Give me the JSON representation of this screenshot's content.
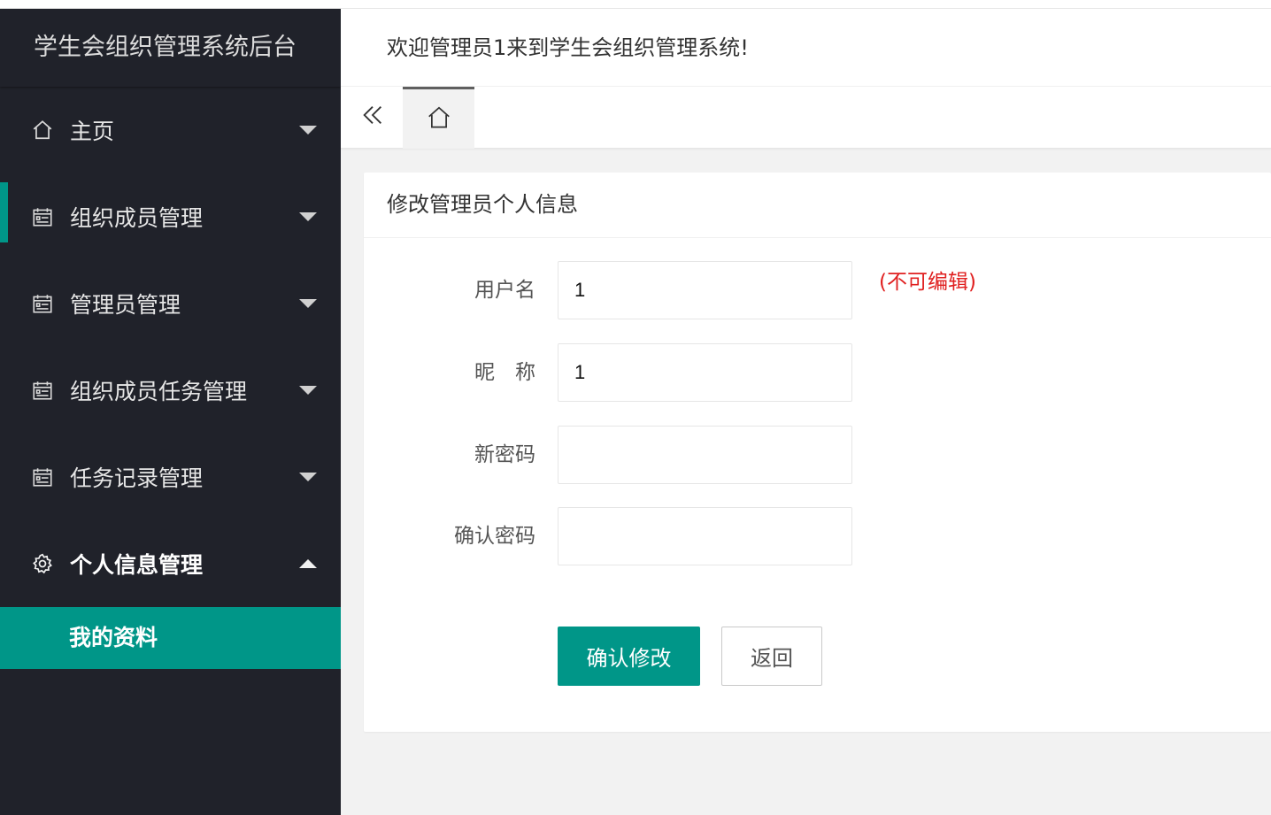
{
  "app": {
    "title": "学生会组织管理系统后台",
    "welcome": "欢迎管理员1来到学生会组织管理系统!"
  },
  "sidebar": {
    "items": [
      {
        "label": "主页",
        "icon": "home-icon",
        "expanded": false
      },
      {
        "label": "组织成员管理",
        "icon": "calendar-icon",
        "expanded": false
      },
      {
        "label": "管理员管理",
        "icon": "calendar-icon",
        "expanded": false
      },
      {
        "label": "组织成员任务管理",
        "icon": "calendar-icon",
        "expanded": false
      },
      {
        "label": "任务记录管理",
        "icon": "calendar-icon",
        "expanded": false
      },
      {
        "label": "个人信息管理",
        "icon": "gear-icon",
        "expanded": true
      }
    ],
    "sub_items": [
      {
        "label": "我的资料",
        "selected": true
      }
    ]
  },
  "tabs": {
    "collapse_icon": "double-chevron-left-icon",
    "home_icon": "home-icon"
  },
  "form": {
    "title": "修改管理员个人信息",
    "username_label": "用户名",
    "username_value": "1",
    "username_hint": "(不可编辑)",
    "nickname_label": "昵　称",
    "nickname_value": "1",
    "new_password_label": "新密码",
    "new_password_value": "",
    "confirm_password_label": "确认密码",
    "confirm_password_value": "",
    "submit_label": "确认修改",
    "back_label": "返回"
  },
  "colors": {
    "primary": "#009688",
    "sidebar_bg": "#20222a",
    "hint": "#e02020"
  }
}
